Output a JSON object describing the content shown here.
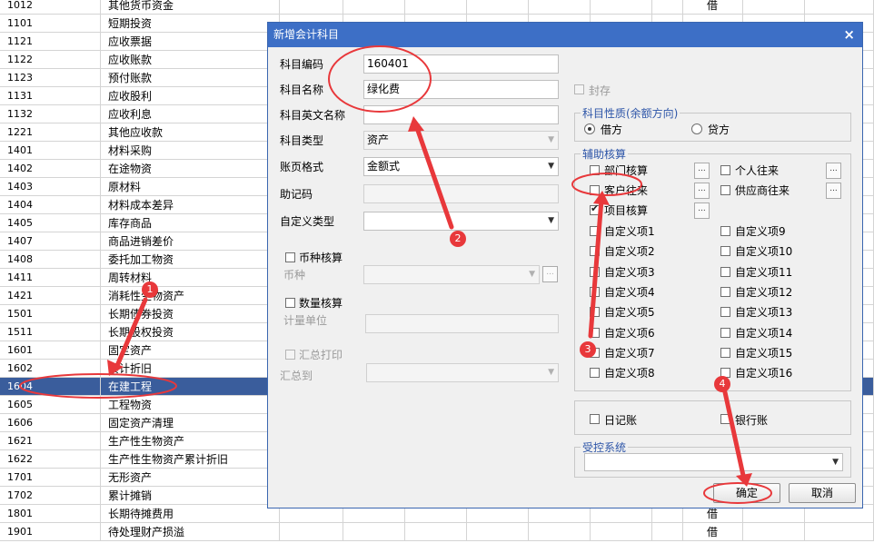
{
  "grid_rows": [
    {
      "code": "1012",
      "name": "其他货币资金",
      "dir": "借"
    },
    {
      "code": "1101",
      "name": "短期投资",
      "dir": ""
    },
    {
      "code": "1121",
      "name": "应收票据",
      "dir": ""
    },
    {
      "code": "1122",
      "name": "应收账款",
      "dir": ""
    },
    {
      "code": "1123",
      "name": "预付账款",
      "dir": ""
    },
    {
      "code": "1131",
      "name": "应收股利",
      "dir": ""
    },
    {
      "code": "1132",
      "name": "应收利息",
      "dir": ""
    },
    {
      "code": "1221",
      "name": "其他应收款",
      "dir": ""
    },
    {
      "code": "1401",
      "name": "材料采购",
      "dir": ""
    },
    {
      "code": "1402",
      "name": "在途物资",
      "dir": ""
    },
    {
      "code": "1403",
      "name": "原材料",
      "dir": ""
    },
    {
      "code": "1404",
      "name": "材料成本差异",
      "dir": ""
    },
    {
      "code": "1405",
      "name": "库存商品",
      "dir": ""
    },
    {
      "code": "1407",
      "name": "商品进销差价",
      "dir": ""
    },
    {
      "code": "1408",
      "name": "委托加工物资",
      "dir": ""
    },
    {
      "code": "1411",
      "name": "周转材料",
      "dir": ""
    },
    {
      "code": "1421",
      "name": "消耗性生物资产",
      "dir": ""
    },
    {
      "code": "1501",
      "name": "长期债券投资",
      "dir": ""
    },
    {
      "code": "1511",
      "name": "长期股权投资",
      "dir": ""
    },
    {
      "code": "1601",
      "name": "固定资产",
      "dir": ""
    },
    {
      "code": "1602",
      "name": "累计折旧",
      "dir": ""
    },
    {
      "code": "1604",
      "name": "在建工程",
      "dir": "",
      "selected": true
    },
    {
      "code": "1605",
      "name": "工程物资",
      "dir": ""
    },
    {
      "code": "1606",
      "name": "固定资产清理",
      "dir": ""
    },
    {
      "code": "1621",
      "name": "生产性生物资产",
      "dir": ""
    },
    {
      "code": "1622",
      "name": "生产性生物资产累计折旧",
      "dir": ""
    },
    {
      "code": "1701",
      "name": "无形资产",
      "dir": ""
    },
    {
      "code": "1702",
      "name": "累计摊销",
      "dir": ""
    },
    {
      "code": "1801",
      "name": "长期待摊费用",
      "dir": "借"
    },
    {
      "code": "1901",
      "name": "待处理财产损溢",
      "dir": "借"
    }
  ],
  "dialog": {
    "title": "新增会计科目",
    "close_glyph": "×",
    "fields": {
      "code_label": "科目编码",
      "code_value": "160401",
      "name_label": "科目名称",
      "name_value": "绿化费",
      "en_name_label": "科目英文名称",
      "en_name_value": "",
      "type_label": "科目类型",
      "type_value": "资产",
      "format_label": "账页格式",
      "format_value": "金额式",
      "mnemonic_label": "助记码",
      "mnemonic_value": "",
      "custom_type_label": "自定义类型",
      "custom_type_value": ""
    },
    "currency_check_label": "币种核算",
    "currency_label": "币种",
    "quantity_check_label": "数量核算",
    "unit_label": "计量单位",
    "summary_print_label": "汇总打印",
    "summary_to_label": "汇总到",
    "seal_label": "封存",
    "nature": {
      "title": "科目性质(余额方向)",
      "debit": "借方",
      "credit": "贷方",
      "selected": "debit"
    },
    "aux": {
      "title": "辅助核算",
      "dept": "部门核算",
      "person": "个人往来",
      "customer": "客户往来",
      "supplier": "供应商往来",
      "project": "项目核算",
      "project_checked": true,
      "custom_left": [
        "自定义项1",
        "自定义项2",
        "自定义项3",
        "自定义项4",
        "自定义项5",
        "自定义项6",
        "自定义项7",
        "自定义项8"
      ],
      "custom_right": [
        "自定义项9",
        "自定义项10",
        "自定义项11",
        "自定义项12",
        "自定义项13",
        "自定义项14",
        "自定义项15",
        "自定义项16"
      ]
    },
    "journal_label": "日记账",
    "bank_label": "银行账",
    "controlled_title": "受控系统",
    "ok_label": "确定",
    "cancel_label": "取消",
    "ellipsis": "..."
  },
  "annotations": {
    "badges": [
      "1",
      "2",
      "3",
      "4"
    ],
    "color": "#e8383b"
  }
}
